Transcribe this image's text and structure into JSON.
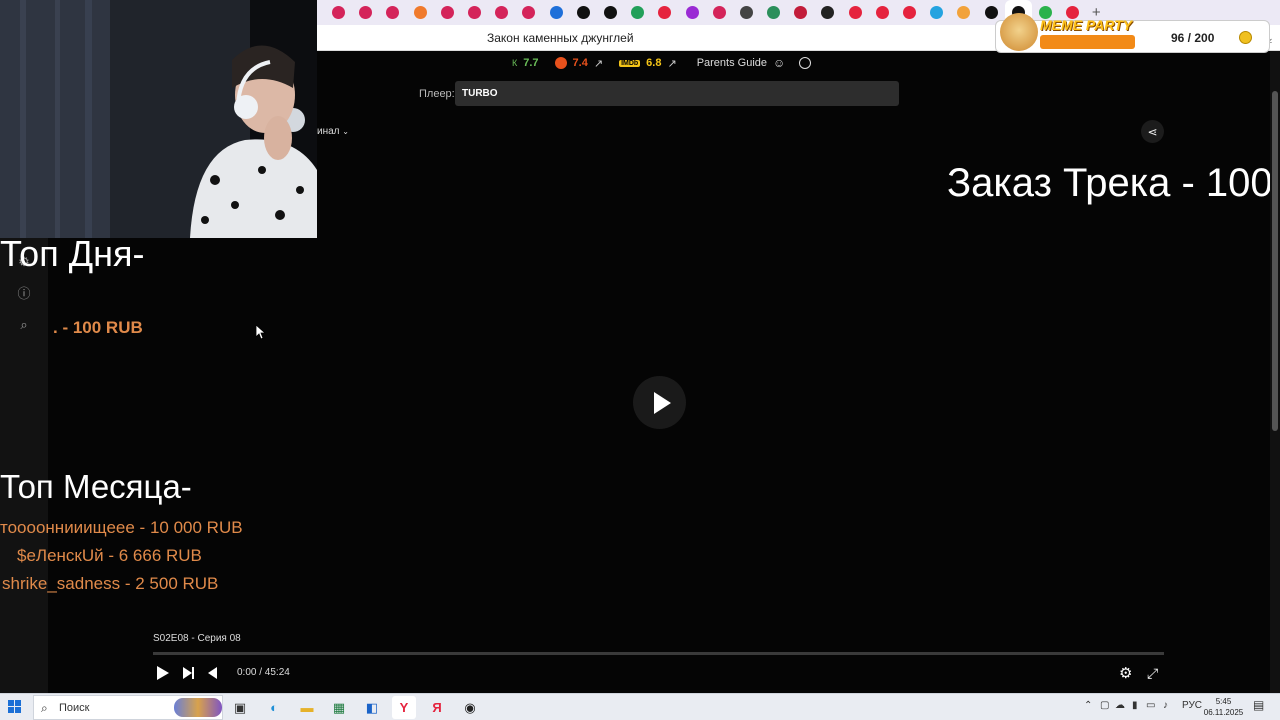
{
  "browser": {
    "page_title": "Закон каменных джунглей",
    "tab_favicon_colors": [
      "#d4245a",
      "#d4245a",
      "#d4245a",
      "#f07a2c",
      "#d4245a",
      "#d4245a",
      "#d4245a",
      "#d4245a",
      "#1e6fd9",
      "#111111",
      "#111111",
      "#22a05a",
      "#e5233e",
      "#9a2ad4",
      "#d4245a",
      "#444444",
      "#2b8f5b",
      "#c21c3a",
      "#222222",
      "#e5233e",
      "#e5233e",
      "#e5233e",
      "#24a3e0",
      "#f2a23a",
      "#111111",
      "#111111",
      "#2bb24c",
      "#e5233e"
    ]
  },
  "ratings": {
    "kp": "7.7",
    "rt": "7.4",
    "imdb_badge": "IMDb",
    "imdb": "6.8",
    "parents_guide": "Parents Guide"
  },
  "player": {
    "label": "Плеер:",
    "selected": "TURBO",
    "audio_dropdown": "инал",
    "episode": "S02E08 - Серия 08",
    "time": "0:00 / 45:24",
    "progress": 0
  },
  "overlay": {
    "order_track": "Заказ Трека - 100",
    "top_day_title": "Топ Дня-",
    "top_day_entry": ". - 100 RUB",
    "top_month_title": "Топ Месяца-",
    "top_month_entries": [
      "тооооннииищеее - 10 000 RUB",
      "$еЛенскUй - 6 666 RUB",
      "shrike_sadness - 2 500 RUB"
    ]
  },
  "meme_party": {
    "title": "MEME PARTY",
    "count": "96 / 200"
  },
  "taskbar": {
    "search_placeholder": "Поиск",
    "lang": "РУС",
    "time": "5:45",
    "date": "06.11.2025"
  }
}
